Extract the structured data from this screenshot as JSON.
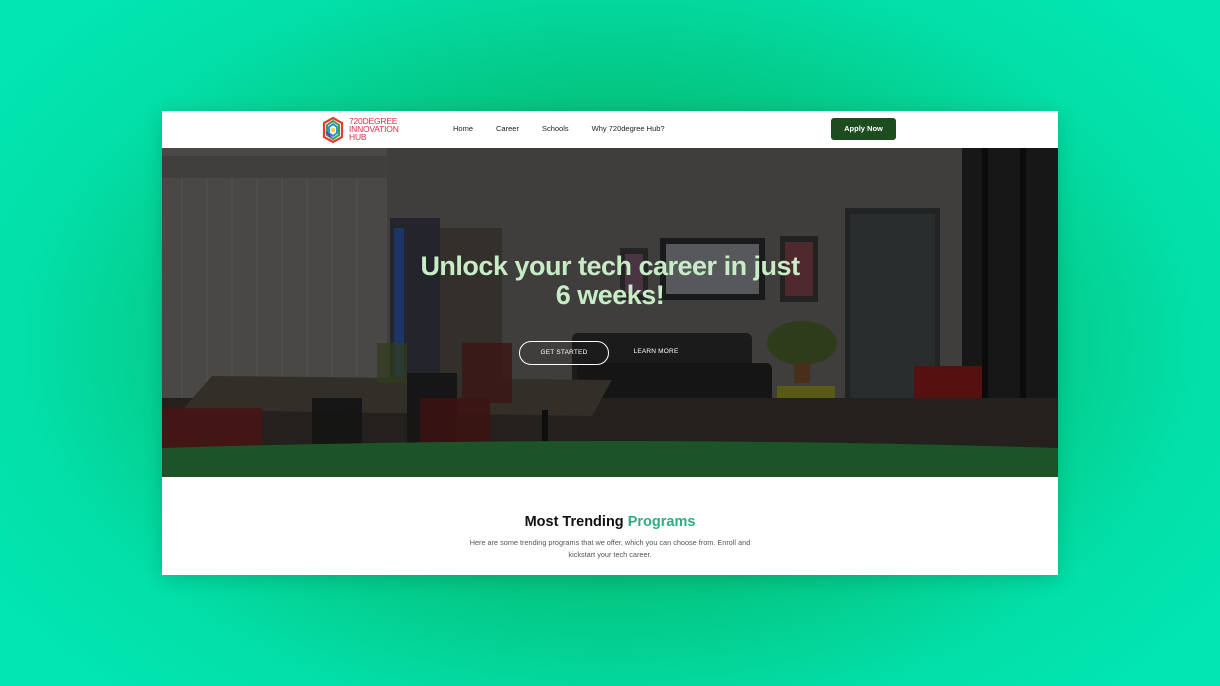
{
  "brand": {
    "name_lines": [
      "720DEGREE",
      "INNOVATION",
      "HUB"
    ],
    "logo_colors": [
      "#e53935",
      "#43a047",
      "#1e88e5",
      "#fdd835",
      "#8e24aa"
    ]
  },
  "nav": {
    "links": [
      {
        "label": "Home"
      },
      {
        "label": "Career"
      },
      {
        "label": "Schools"
      },
      {
        "label": "Why 720degree Hub?"
      }
    ],
    "apply_label": "Apply Now"
  },
  "hero": {
    "title": "Unlock your tech career in just 6 weeks!",
    "primary_button": "GET STARTED",
    "secondary_button": "LEARN MORE",
    "image_description": "office-room-background"
  },
  "programs": {
    "title_part1": "Most Trending",
    "title_part2": "Programs",
    "description": "Here are some trending programs that we offer, which you can choose from. Enroll and kickstart your tech career."
  },
  "colors": {
    "accent_green": "#2fae7d",
    "dark_green": "#1d4d1f",
    "hero_text": "#c7ecc6",
    "background_teal": "#02e6b2"
  }
}
